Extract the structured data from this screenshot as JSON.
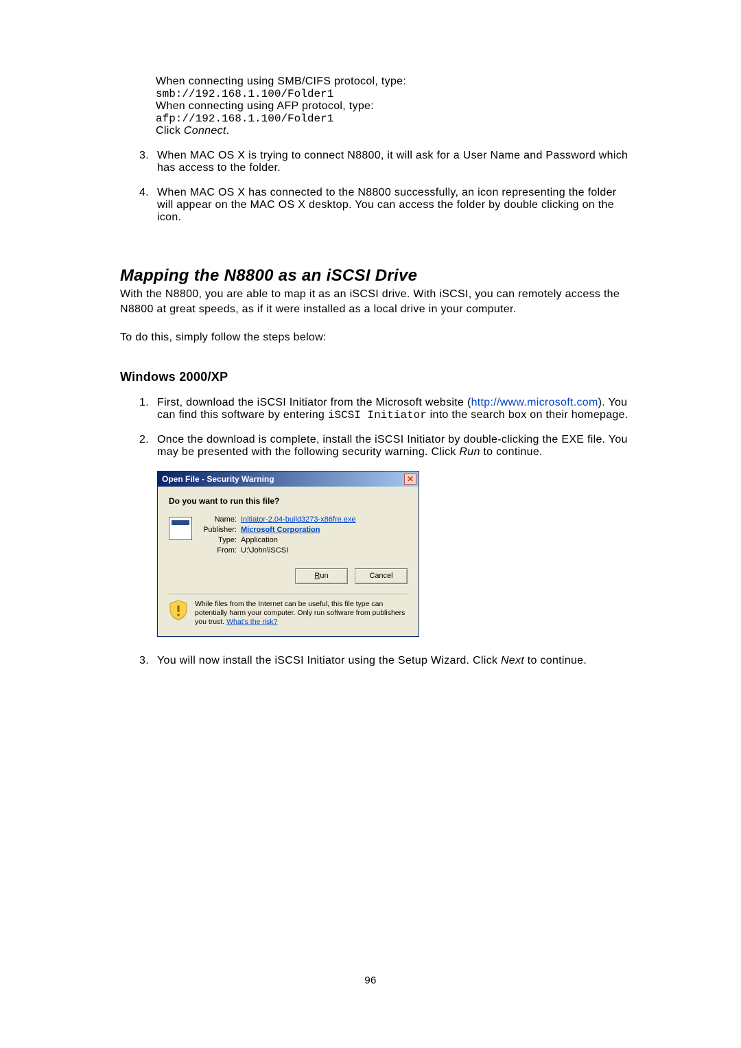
{
  "intro": {
    "line1": "When connecting using SMB/CIFS protocol, type:",
    "code1": "smb://192.168.1.100/Folder1",
    "line2": "When connecting using AFP protocol, type:",
    "code2": "afp://192.168.1.100/Folder1",
    "line3a": "Click ",
    "line3b": "Connect",
    "line3c": "."
  },
  "item3": {
    "num": "3.",
    "text": "When MAC OS X is trying to connect N8800, it will ask for a User Name and Password which has access to the folder."
  },
  "item4": {
    "num": "4.",
    "text": "When MAC OS X has connected to the N8800 successfully, an icon representing the folder will appear on the MAC OS X desktop. You can access the folder by double clicking on the icon."
  },
  "section_title": "Mapping the N8800 as an iSCSI Drive",
  "section_para": "With the N8800, you are able to map it as an iSCSI drive. With iSCSI, you can remotely access the N8800 at great speeds, as if it were installed as a local drive in your computer.",
  "section_para2": "To do this, simply follow the steps below:",
  "sub_title": "Windows 2000/XP",
  "win1": {
    "num": "1.",
    "pre": "First, download the iSCSI Initiator from the Microsoft website (",
    "link": "http://www.microsoft.com",
    "post1": "). You can find this software by entering ",
    "code": "iSCSI Initiator",
    "post2": " into the search box on their homepage."
  },
  "win2": {
    "num": "2.",
    "pre": "Once the download is complete, install the iSCSI Initiator by double-clicking the EXE file. You may be presented with the following security warning. Click ",
    "run": "Run",
    "post": " to continue."
  },
  "dialog": {
    "title": "Open File - Security Warning",
    "close": "✕",
    "question": "Do you want to run this file?",
    "name_label": "Name:",
    "name_value": "Initiator-2.04-build3273-x86fre.exe",
    "publisher_label": "Publisher:",
    "publisher_value": "Microsoft Corporation",
    "type_label": "Type:",
    "type_value": "Application",
    "from_label": "From:",
    "from_value": "U:\\John\\iSCSI",
    "btn_run_u": "R",
    "btn_run_rest": "un",
    "btn_cancel": "Cancel",
    "warn_text": "While files from the Internet can be useful, this file type can potentially harm your computer. Only run software from publishers you trust. ",
    "warn_link": "What's the risk?"
  },
  "win3": {
    "num": "3.",
    "pre": "You will now install the iSCSI Initiator using the Setup Wizard. Click ",
    "next": "Next",
    "post": " to continue."
  },
  "page_num": "96"
}
